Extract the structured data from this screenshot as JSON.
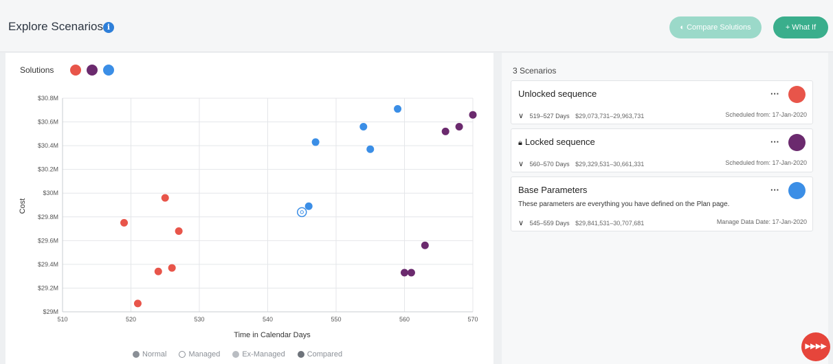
{
  "header": {
    "title": "Explore Scenarios",
    "info_icon": "info-icon",
    "compare_label": "Compare Solutions",
    "whatif_label": "+ What If"
  },
  "solutions": {
    "label": "Solutions",
    "colors": [
      "#e8554a",
      "#6b2a6e",
      "#3b8ee6"
    ]
  },
  "chart_data": {
    "type": "scatter",
    "xlabel": "Time in Calendar Days",
    "ylabel": "Cost",
    "xlim": [
      510,
      570
    ],
    "ylim": [
      29.0,
      30.8
    ],
    "x_ticks": [
      "510",
      "520",
      "530",
      "540",
      "550",
      "560",
      "570"
    ],
    "y_ticks": [
      "$29M",
      "$29.2M",
      "$29.4M",
      "$29.6M",
      "$29.8M",
      "$30M",
      "$30.2M",
      "$30.4M",
      "$30.6M",
      "$30.8M"
    ],
    "grid": true,
    "series": [
      {
        "color": "#e8554a",
        "points": [
          [
            519,
            29.75
          ],
          [
            521,
            29.07
          ],
          [
            524,
            29.34
          ],
          [
            525,
            29.96
          ],
          [
            526,
            29.37
          ],
          [
            527,
            29.68
          ]
        ]
      },
      {
        "color": "#6b2a6e",
        "points": [
          [
            560,
            29.33
          ],
          [
            561,
            29.33
          ],
          [
            563,
            29.56
          ],
          [
            566,
            30.52
          ],
          [
            568,
            30.56
          ],
          [
            570,
            30.66
          ]
        ]
      },
      {
        "color": "#3b8ee6",
        "points": [
          [
            546,
            29.89
          ],
          [
            547,
            30.43
          ],
          [
            554,
            30.56
          ],
          [
            555,
            30.37
          ],
          [
            559,
            30.71
          ]
        ]
      }
    ],
    "managed_points": [
      [
        545,
        29.84
      ]
    ],
    "legend": [
      "Normal",
      "Managed",
      "Ex-Managed",
      "Compared"
    ],
    "legend_position": "bottom"
  },
  "panel": {
    "count_text": "3 Scenarios",
    "cards": [
      {
        "name": "Unlocked sequence",
        "days": "519–527",
        "days_unit": "Days",
        "range": "$29,073,731–29,963,731",
        "info": "Scheduled from: 17-Jan-2020",
        "color": "#e8554a",
        "more": "···"
      },
      {
        "name": "Locked sequence",
        "days": "560–570",
        "days_unit": "Days",
        "range": "$29,329,531–30,661,331",
        "info": "Scheduled from: 17-Jan-2020",
        "color": "#6b2a6e",
        "more": "···"
      },
      {
        "name": "Base Parameters",
        "description": "These parameters are everything you have defined on the Plan page.",
        "days": "545–559",
        "days_unit": "Days",
        "range": "$29,841,531–30,707,681",
        "info": "Manage Data Date: 17-Jan-2020",
        "color": "#3b8ee6",
        "more": "···"
      }
    ]
  },
  "badge": {
    "label": "▶▶▶▶"
  }
}
